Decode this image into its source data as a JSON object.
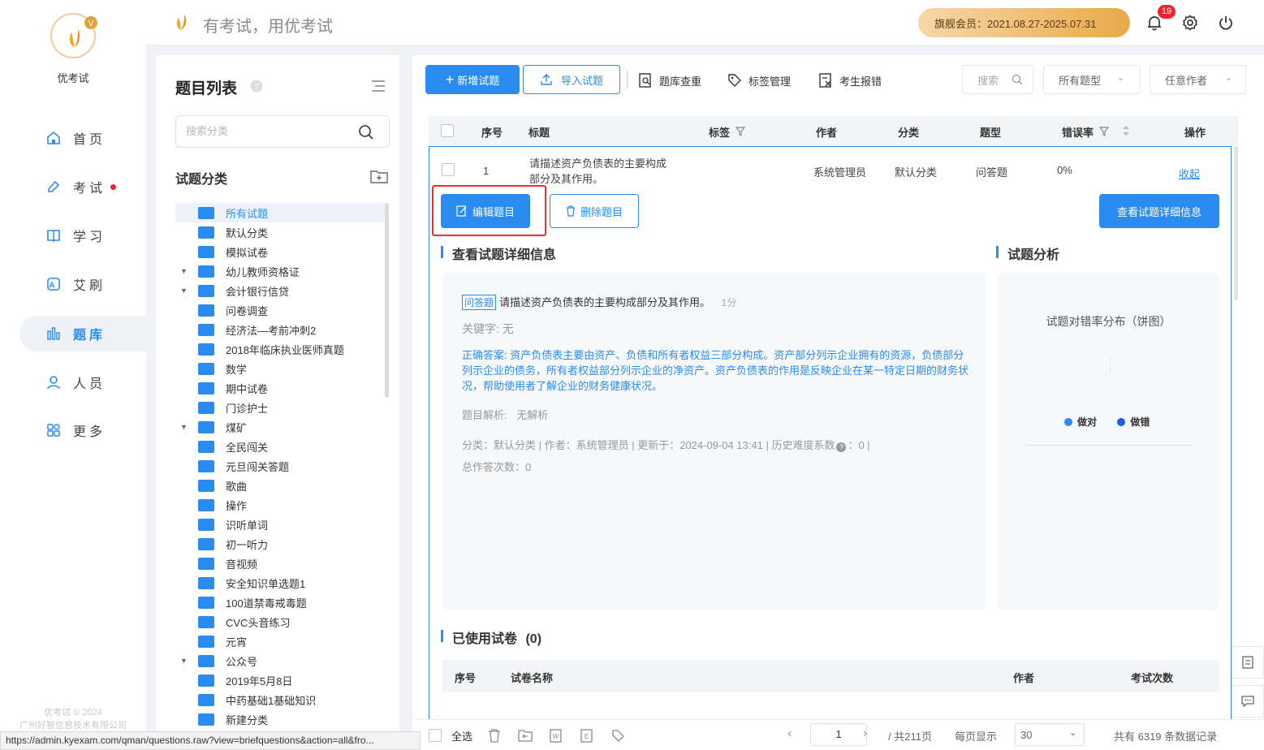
{
  "app": {
    "name": "优考试",
    "slogan": "有考试，用优考试",
    "copyright": "优考试 © 2024",
    "company": "广州好智信息技术有限公司"
  },
  "header": {
    "membership": "旗舰会员：2021.08.27-2025.07.31",
    "notification_count": "19"
  },
  "nav": [
    {
      "label": "首页",
      "icon": "home-icon"
    },
    {
      "label": "考试",
      "icon": "exam-icon",
      "dot": true
    },
    {
      "label": "学习",
      "icon": "book-icon"
    },
    {
      "label": "艾刷",
      "icon": "a-icon"
    },
    {
      "label": "题库",
      "icon": "bar-chart-icon",
      "active": true
    },
    {
      "label": "人员",
      "icon": "user-icon"
    },
    {
      "label": "更多",
      "icon": "grid-icon"
    }
  ],
  "left_panel": {
    "title": "题目列表",
    "search_placeholder": "搜索分类",
    "section_title": "试题分类",
    "categories": [
      {
        "label": "所有试题",
        "selected": true
      },
      {
        "label": "默认分类"
      },
      {
        "label": "模拟试卷"
      },
      {
        "label": "幼儿教师资格证",
        "expandable": true
      },
      {
        "label": "会计银行信贷",
        "expandable": true
      },
      {
        "label": "问卷调查"
      },
      {
        "label": "经济法—考前冲刺2"
      },
      {
        "label": "2018年临床执业医师真题"
      },
      {
        "label": "数学"
      },
      {
        "label": "期中试卷"
      },
      {
        "label": "门诊护士"
      },
      {
        "label": "煤矿",
        "expandable": true
      },
      {
        "label": "全民闯关"
      },
      {
        "label": "元旦闯关答题"
      },
      {
        "label": "歌曲"
      },
      {
        "label": "操作"
      },
      {
        "label": "识听单词"
      },
      {
        "label": "初一听力"
      },
      {
        "label": "音视频"
      },
      {
        "label": "安全知识单选题1"
      },
      {
        "label": "100道禁毒戒毒题"
      },
      {
        "label": "CVC头音练习"
      },
      {
        "label": "元宵"
      },
      {
        "label": "公众号",
        "expandable": true
      },
      {
        "label": "2019年5月8日"
      },
      {
        "label": "中药基础1基础知识"
      },
      {
        "label": "新建分类"
      }
    ]
  },
  "toolbar": {
    "add_label": "新增试题",
    "import_label": "导入试题",
    "dedupe_label": "题库查重",
    "tags_label": "标签管理",
    "report_label": "考生报错",
    "search_placeholder": "搜索",
    "type_filter": "所有题型",
    "author_filter": "任意作者"
  },
  "table": {
    "headers": {
      "index": "序号",
      "title": "标题",
      "tags": "标签",
      "author": "作者",
      "category": "分类",
      "type": "题型",
      "error_rate": "错误率",
      "actions": "操作"
    },
    "row": {
      "index": "1",
      "title_line1": "请描述资产负债表的主要构成",
      "title_line2": "部分及其作用。",
      "author": "系统管理员",
      "category": "默认分类",
      "type": "问答题",
      "error_rate": "0%",
      "action": "收起"
    }
  },
  "detail": {
    "edit_label": "编辑题目",
    "delete_label": "删除题目",
    "view_detail_label": "查看试题详细信息",
    "detail_heading": "查看试题详细信息",
    "analysis_heading": "试题分析",
    "question_type_tag": "问答题",
    "question_text": "请描述资产负债表的主要构成部分及其作用。",
    "score": "1分",
    "keywords": "关键字: 无",
    "answer": "正确答案: 资产负债表主要由资产、负债和所有者权益三部分构成。资产部分列示企业拥有的资源，负债部分列示企业的债务，所有者权益部分列示企业的净资产。资产负债表的作用是反映企业在某一特定日期的财务状况，帮助使用者了解企业的财务健康状况。",
    "analysis_label": "题目解析:",
    "analysis_value": "无解析",
    "meta": "分类：默认分类 | 作者：系统管理员 | 更新于：2024-09-04 13:41 | 历史难度系数",
    "meta_tail": "：0 |",
    "total_answers": "总作答次数：0",
    "chart_title": "试题对错率分布（饼图）",
    "legend_right": "做对",
    "legend_wrong": "做错",
    "legend_right_color": "#2a8cf0",
    "legend_wrong_color": "#1d5be0",
    "used_papers": "已使用试卷",
    "used_count": "(0)",
    "papers_headers": {
      "index": "序号",
      "name": "试卷名称",
      "author": "作者",
      "count": "考试次数"
    }
  },
  "bottom": {
    "select_all": "全选",
    "page": "1",
    "total_pages": "/ 共211页",
    "per_page_label": "每页显示",
    "per_page": "30",
    "total_records": "共有 6319 条数据记录"
  },
  "status_url": "https://admin.kyexam.com/qman/questions.raw?view=briefquestions&action=all&fro..."
}
